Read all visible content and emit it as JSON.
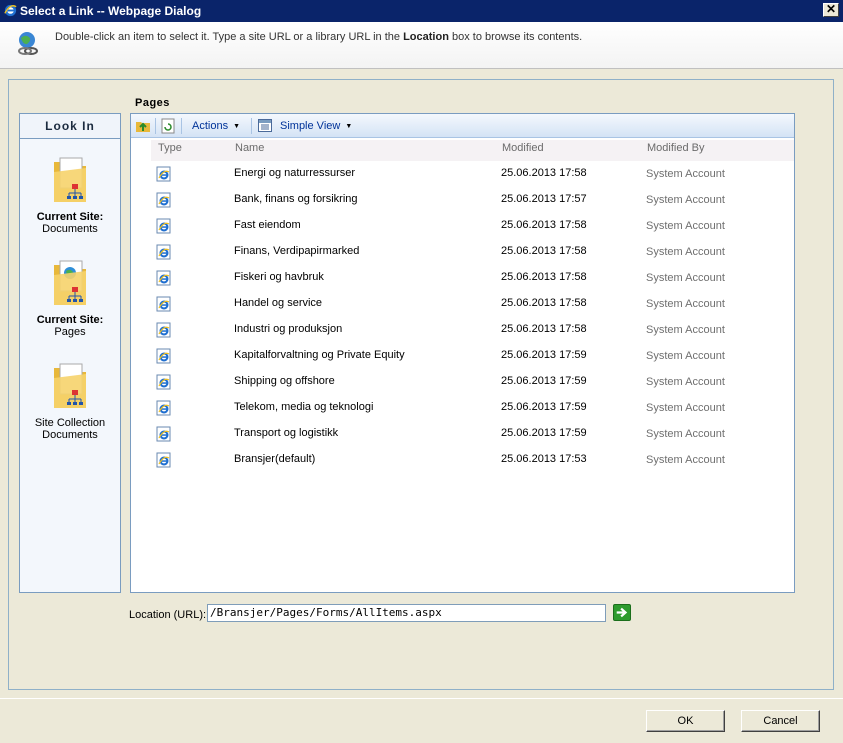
{
  "window": {
    "title": "Select a Link -- Webpage Dialog",
    "close_label": "✕"
  },
  "info": {
    "text_before": "Double-click an item to select it. Type a site URL or a library URL in the ",
    "text_bold": "Location",
    "text_after": " box to browse its contents."
  },
  "look_in": {
    "header": "Look In",
    "sites": [
      {
        "name": "Current Site:",
        "sub": "Documents"
      },
      {
        "name": "Current Site:",
        "sub": "Pages"
      },
      {
        "name": "",
        "sub": "Site Collection Documents"
      }
    ]
  },
  "list": {
    "title": "Pages",
    "toolbar": {
      "actions": "Actions",
      "view": "Simple View"
    },
    "columns": {
      "type": "Type",
      "name": "Name",
      "modified": "Modified",
      "modified_by": "Modified By"
    },
    "rows": [
      {
        "name": "Energi og naturressurser",
        "modified": "25.06.2013 17:58",
        "by": "System Account"
      },
      {
        "name": "Bank, finans og forsikring",
        "modified": "25.06.2013 17:57",
        "by": "System Account"
      },
      {
        "name": "Fast eiendom",
        "modified": "25.06.2013 17:58",
        "by": "System Account"
      },
      {
        "name": "Finans, Verdipapirmarked",
        "modified": "25.06.2013 17:58",
        "by": "System Account"
      },
      {
        "name": "Fiskeri og havbruk",
        "modified": "25.06.2013 17:58",
        "by": "System Account"
      },
      {
        "name": "Handel og service",
        "modified": "25.06.2013 17:58",
        "by": "System Account"
      },
      {
        "name": "Industri og produksjon",
        "modified": "25.06.2013 17:58",
        "by": "System Account"
      },
      {
        "name": "Kapitalforvaltning og Private Equity",
        "modified": "25.06.2013 17:59",
        "by": "System Account"
      },
      {
        "name": "Shipping og offshore",
        "modified": "25.06.2013 17:59",
        "by": "System Account"
      },
      {
        "name": "Telekom, media og teknologi",
        "modified": "25.06.2013 17:59",
        "by": "System Account"
      },
      {
        "name": "Transport og logistikk",
        "modified": "25.06.2013 17:59",
        "by": "System Account"
      },
      {
        "name": "Bransjer(default)",
        "modified": "25.06.2013 17:53",
        "by": "System Account"
      }
    ]
  },
  "location": {
    "label": "Location (URL):",
    "value": "/Bransjer/Pages/Forms/AllItems.aspx"
  },
  "buttons": {
    "ok": "OK",
    "cancel": "Cancel"
  }
}
